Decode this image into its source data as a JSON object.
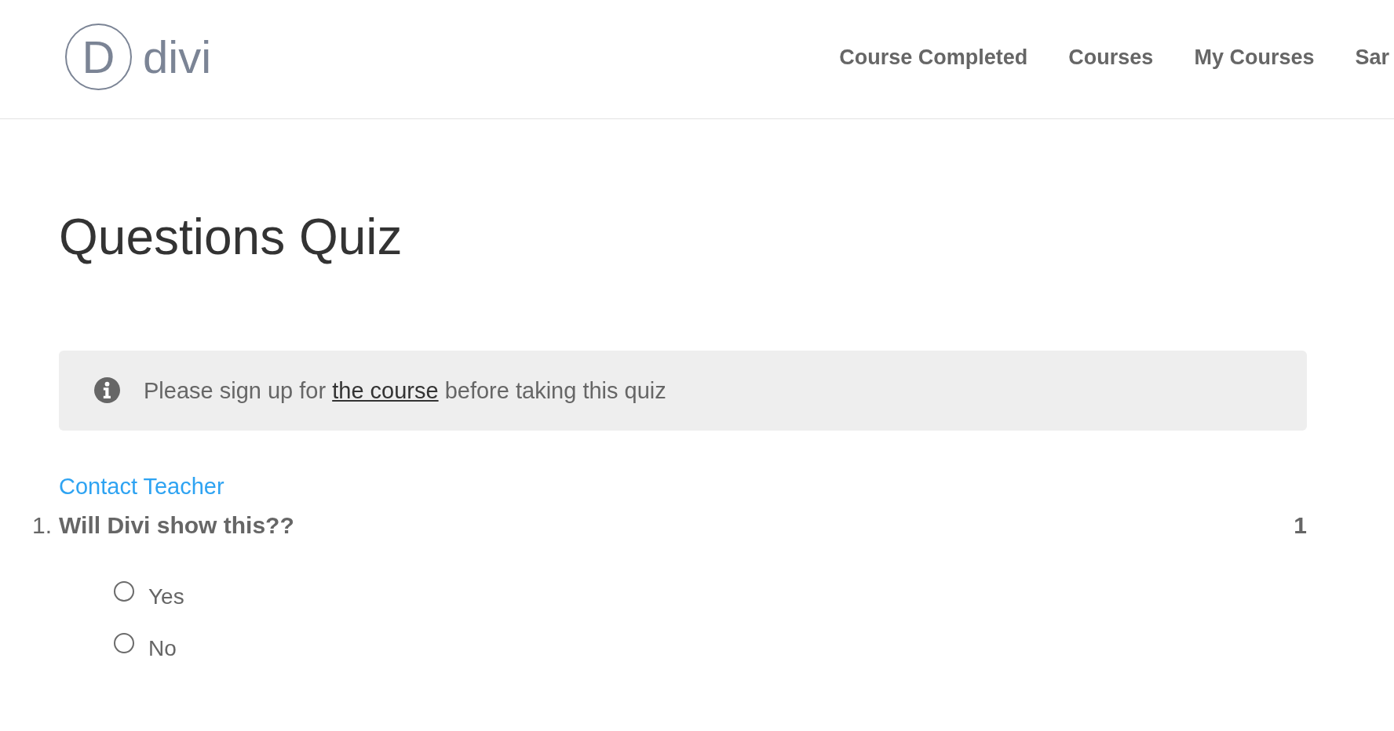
{
  "header": {
    "logo": {
      "mark": "D",
      "wordmark": "divi"
    },
    "nav": [
      {
        "label": "Course Completed"
      },
      {
        "label": "Courses"
      },
      {
        "label": "My Courses"
      },
      {
        "label": "Sar"
      }
    ]
  },
  "page_title": "Questions Quiz",
  "notice": {
    "text_before": "Please sign up for ",
    "link": "the course",
    "text_after": " before taking this quiz"
  },
  "contact_link": "Contact Teacher",
  "questions": [
    {
      "number": "1.",
      "text": "Will Divi show this??",
      "points": "1",
      "answers": [
        {
          "label": "Yes",
          "selected": false
        },
        {
          "label": "No",
          "selected": false
        }
      ]
    }
  ]
}
